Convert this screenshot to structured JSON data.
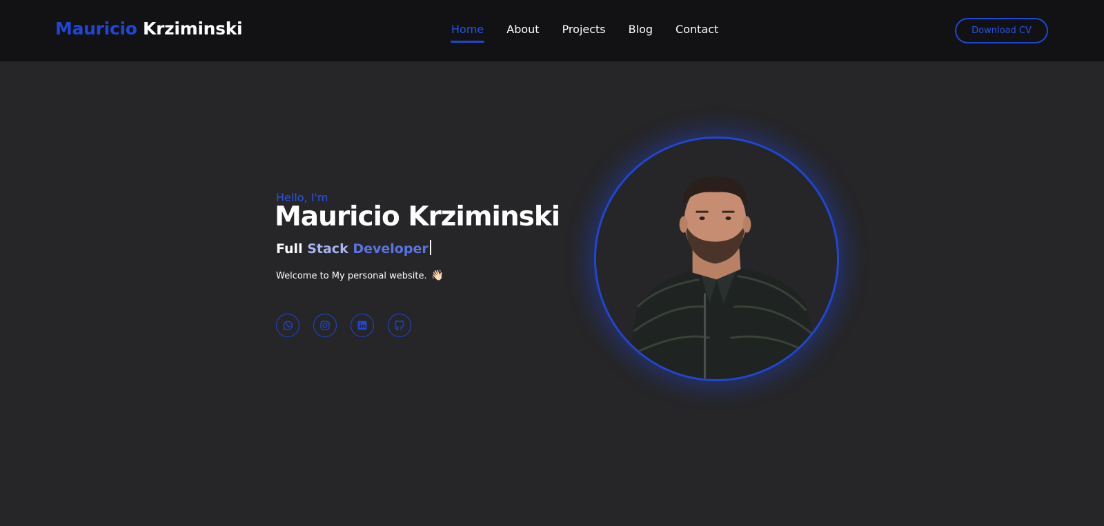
{
  "header": {
    "logo_first": "Mauricio",
    "logo_last": "Krziminski",
    "nav": [
      {
        "label": "Home",
        "active": true
      },
      {
        "label": "About",
        "active": false
      },
      {
        "label": "Projects",
        "active": false
      },
      {
        "label": "Blog",
        "active": false
      },
      {
        "label": "Contact",
        "active": false
      }
    ],
    "cv_button": "Download CV"
  },
  "hero": {
    "greeting": "Hello, I'm",
    "name": "Mauricio Krziminski",
    "role_words": [
      "Full",
      "Stack",
      "Developer"
    ],
    "welcome": "Welcome to My personal website.",
    "wave_emoji": "👋🏻",
    "socials": [
      {
        "icon": "whatsapp-icon"
      },
      {
        "icon": "instagram-icon"
      },
      {
        "icon": "linkedin-icon"
      },
      {
        "icon": "github-icon"
      }
    ]
  },
  "colors": {
    "accent": "#2146d6",
    "header_bg": "#121214",
    "page_bg": "#262628",
    "text": "#ffffff"
  }
}
